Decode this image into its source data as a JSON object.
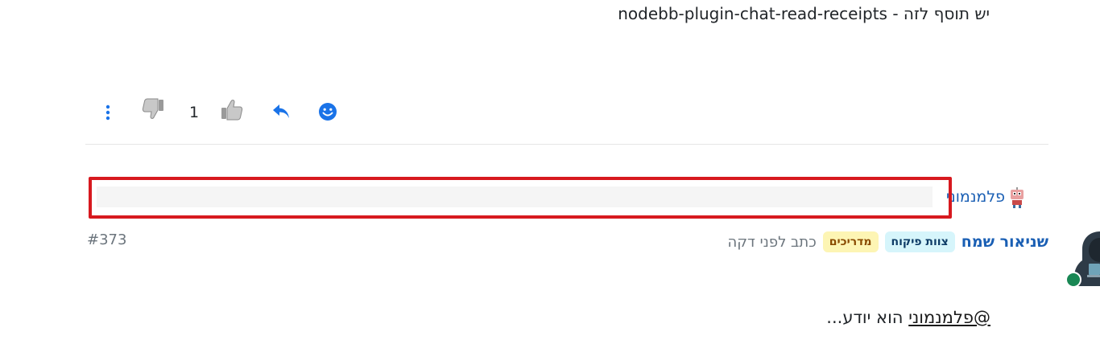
{
  "previous_post": {
    "text_prefix": "יש תוסף לזה - ",
    "plugin_name": "nodebb-plugin-chat-read-receipts"
  },
  "actions": {
    "vote_count": "1",
    "icons": [
      "more-vertical-icon",
      "thumbs-down-icon",
      "thumbs-up-icon",
      "reply-icon",
      "smiley-icon"
    ]
  },
  "typing_indicator": {
    "name": "פלמנמוני"
  },
  "post": {
    "author": "שניאור שמח",
    "badges": {
      "staff": "צוות פיקוח",
      "guides": "מדריכים"
    },
    "timestamp": "כתב לפני דקה",
    "number": "#373",
    "mention": "@פלמנמוני",
    "body_rest": " הוא יודע..."
  },
  "colors": {
    "link": "#1a5fb4",
    "highlight": "#d7191f",
    "online": "#198754",
    "staff_badge_bg": "#d6f5fb",
    "guides_badge_bg": "#fdf5b4"
  }
}
